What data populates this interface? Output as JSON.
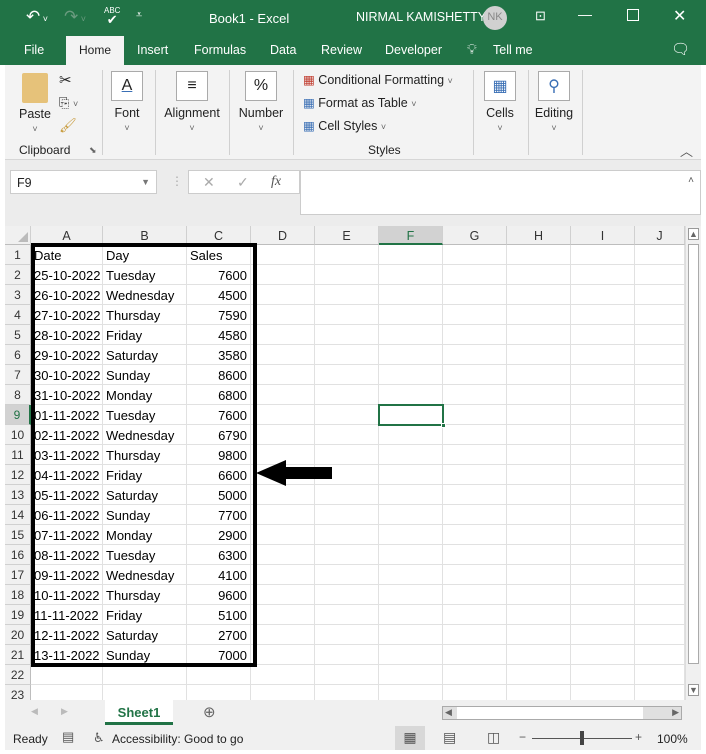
{
  "titlebar": {
    "title": "Book1  -  Excel",
    "user": "NIRMAL KAMISHETTY",
    "initials": "NK"
  },
  "menu": {
    "tabs": [
      "File",
      "Home",
      "Insert",
      "Formulas",
      "Data",
      "Review",
      "Developer",
      "Tell me"
    ]
  },
  "ribbon": {
    "paste": "Paste",
    "clipboard": "Clipboard",
    "font": "Font",
    "alignment": "Alignment",
    "number": "Number",
    "conditional": "Conditional Formatting",
    "format_table": "Format as Table",
    "cell_styles": "Cell Styles",
    "styles": "Styles",
    "cells": "Cells",
    "editing": "Editing"
  },
  "formula_bar": {
    "name_box": "F9",
    "formula": ""
  },
  "sheet": {
    "columns": [
      "A",
      "B",
      "C",
      "D",
      "E",
      "F",
      "G",
      "H",
      "I",
      "J"
    ],
    "selected_cell": "F9",
    "rows": [
      [
        "Date",
        "Day",
        "Sales"
      ],
      [
        "25-10-2022",
        "Tuesday",
        "7600"
      ],
      [
        "26-10-2022",
        "Wednesday",
        "4500"
      ],
      [
        "27-10-2022",
        "Thursday",
        "7590"
      ],
      [
        "28-10-2022",
        "Friday",
        "4580"
      ],
      [
        "29-10-2022",
        "Saturday",
        "3580"
      ],
      [
        "30-10-2022",
        "Sunday",
        "8600"
      ],
      [
        "31-10-2022",
        "Monday",
        "6800"
      ],
      [
        "01-11-2022",
        "Tuesday",
        "7600"
      ],
      [
        "02-11-2022",
        "Wednesday",
        "6790"
      ],
      [
        "03-11-2022",
        "Thursday",
        "9800"
      ],
      [
        "04-11-2022",
        "Friday",
        "6600"
      ],
      [
        "05-11-2022",
        "Saturday",
        "5000"
      ],
      [
        "06-11-2022",
        "Sunday",
        "7700"
      ],
      [
        "07-11-2022",
        "Monday",
        "2900"
      ],
      [
        "08-11-2022",
        "Tuesday",
        "6300"
      ],
      [
        "09-11-2022",
        "Wednesday",
        "4100"
      ],
      [
        "10-11-2022",
        "Thursday",
        "9600"
      ],
      [
        "11-11-2022",
        "Friday",
        "5100"
      ],
      [
        "12-11-2022",
        "Saturday",
        "2700"
      ],
      [
        "13-11-2022",
        "Sunday",
        "7000"
      ],
      [],
      []
    ],
    "tab": "Sheet1"
  },
  "status": {
    "ready": "Ready",
    "accessibility": "Accessibility: Good to go",
    "zoom": "100%"
  },
  "colors": {
    "brand": "#217346",
    "selection": "#217346"
  }
}
